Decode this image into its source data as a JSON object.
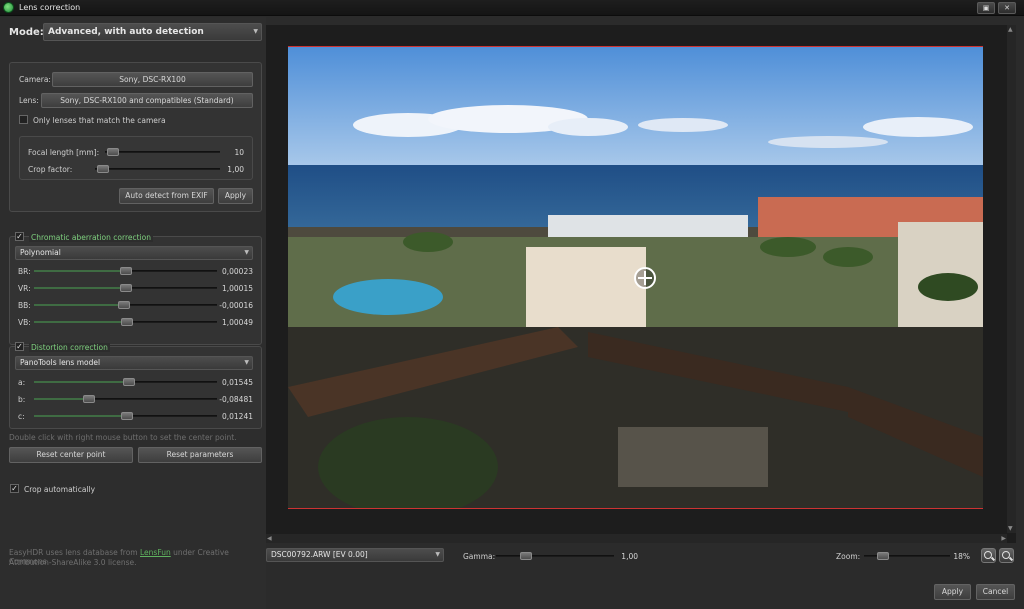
{
  "window": {
    "title": "Lens correction"
  },
  "mode": {
    "label": "Mode:",
    "value": "Advanced, with auto detection"
  },
  "lens_group": {
    "camera_label": "Camera:",
    "camera_value": "Sony, DSC-RX100",
    "lens_label": "Lens:",
    "lens_value": "Sony, DSC-RX100 and compatibles (Standard)",
    "only_match_label": "Only lenses that match the camera",
    "focal_label": "Focal length [mm]:",
    "focal_value": "10",
    "crop_label": "Crop factor:",
    "crop_value": "1,00",
    "auto_detect_button": "Auto detect from EXIF",
    "apply_button": "Apply"
  },
  "chromatic": {
    "label": "Chromatic aberration correction",
    "model": "Polynomial",
    "params": [
      {
        "name": "BR:",
        "value": "0,00023",
        "level": 0.5
      },
      {
        "name": "VR:",
        "value": "1,00015",
        "level": 0.5
      },
      {
        "name": "BB:",
        "value": "-0,00016",
        "level": 0.49
      },
      {
        "name": "VB:",
        "value": "1,00049",
        "level": 0.51
      }
    ]
  },
  "distortion": {
    "label": "Distortion correction",
    "model": "PanoTools lens model",
    "params": [
      {
        "name": "a:",
        "value": "0,01545",
        "level": 0.52
      },
      {
        "name": "b:",
        "value": "-0,08481",
        "level": 0.3
      },
      {
        "name": "c:",
        "value": "0,01241",
        "level": 0.51
      }
    ]
  },
  "hint_text": "Double click with right mouse button to set the center point.",
  "reset_center_button": "Reset center point",
  "reset_params_button": "Reset parameters",
  "crop_auto_label": "Crop automatically",
  "footer": {
    "line1_pre": "EasyHDR uses lens database from ",
    "link": "LensFun",
    "line1_post": " under Creative Commons",
    "line2": "Attribution-ShareAlike 3.0 license."
  },
  "bottom": {
    "file_value": "DSC00792.ARW [EV 0.00]",
    "gamma_label": "Gamma:",
    "gamma_value": "1,00",
    "gamma_level": 0.2,
    "zoom_label": "Zoom:",
    "zoom_value": "18%",
    "zoom_level": 0.15
  },
  "apply_button": "Apply",
  "cancel_button": "Cancel",
  "colors": {
    "accent_green": "#7fd17f",
    "crop_line": "#cc3333"
  }
}
